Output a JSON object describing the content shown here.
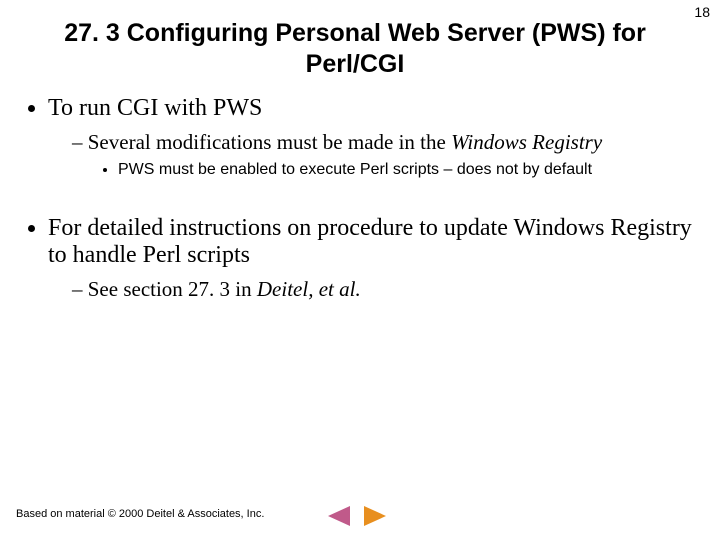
{
  "page_number": "18",
  "title": "27. 3 Configuring Personal Web Server (PWS) for Perl/CGI",
  "bullets": {
    "b1": "To run CGI with PWS",
    "b1_1_pre": "Several modifications must be made in the ",
    "b1_1_em": "Windows Registry",
    "b1_1_1": "PWS must be enabled to execute Perl scripts – does not by default",
    "b2": "For detailed instructions on procedure to update Windows Registry to handle Perl scripts",
    "b2_1_pre": "See section 27. 3 in ",
    "b2_1_em": "Deitel, et al."
  },
  "footer": "Based on material © 2000 Deitel & Associates, Inc.",
  "nav": {
    "prev_color": "#c05a8a",
    "next_color": "#e88f1f"
  }
}
